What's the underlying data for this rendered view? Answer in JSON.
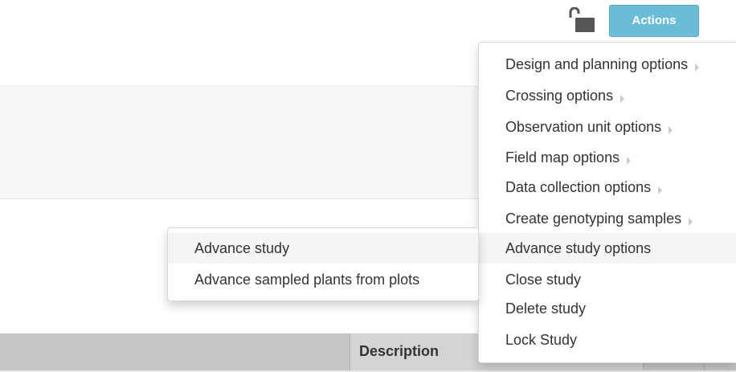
{
  "header": {
    "lock_icon": "unlocked-padlock-icon",
    "actions_label": "Actions",
    "actions_color": "#6bbcd9"
  },
  "actions_menu": {
    "items": [
      {
        "label": "Design and planning options",
        "has_submenu": true
      },
      {
        "label": "Crossing options",
        "has_submenu": true
      },
      {
        "label": "Observation unit options",
        "has_submenu": true
      },
      {
        "label": "Field map options",
        "has_submenu": true
      },
      {
        "label": "Data collection options",
        "has_submenu": true
      },
      {
        "label": "Create genotyping samples",
        "has_submenu": true
      },
      {
        "label": "Advance study options",
        "has_submenu": false
      },
      {
        "label": "Close study",
        "has_submenu": false
      },
      {
        "label": "Delete study",
        "has_submenu": false
      },
      {
        "label": "Lock Study",
        "has_submenu": false
      }
    ]
  },
  "advance_submenu": {
    "items": [
      {
        "label": "Advance study"
      },
      {
        "label": "Advance sampled plants from plots"
      }
    ]
  },
  "table": {
    "header_description": "Description"
  }
}
